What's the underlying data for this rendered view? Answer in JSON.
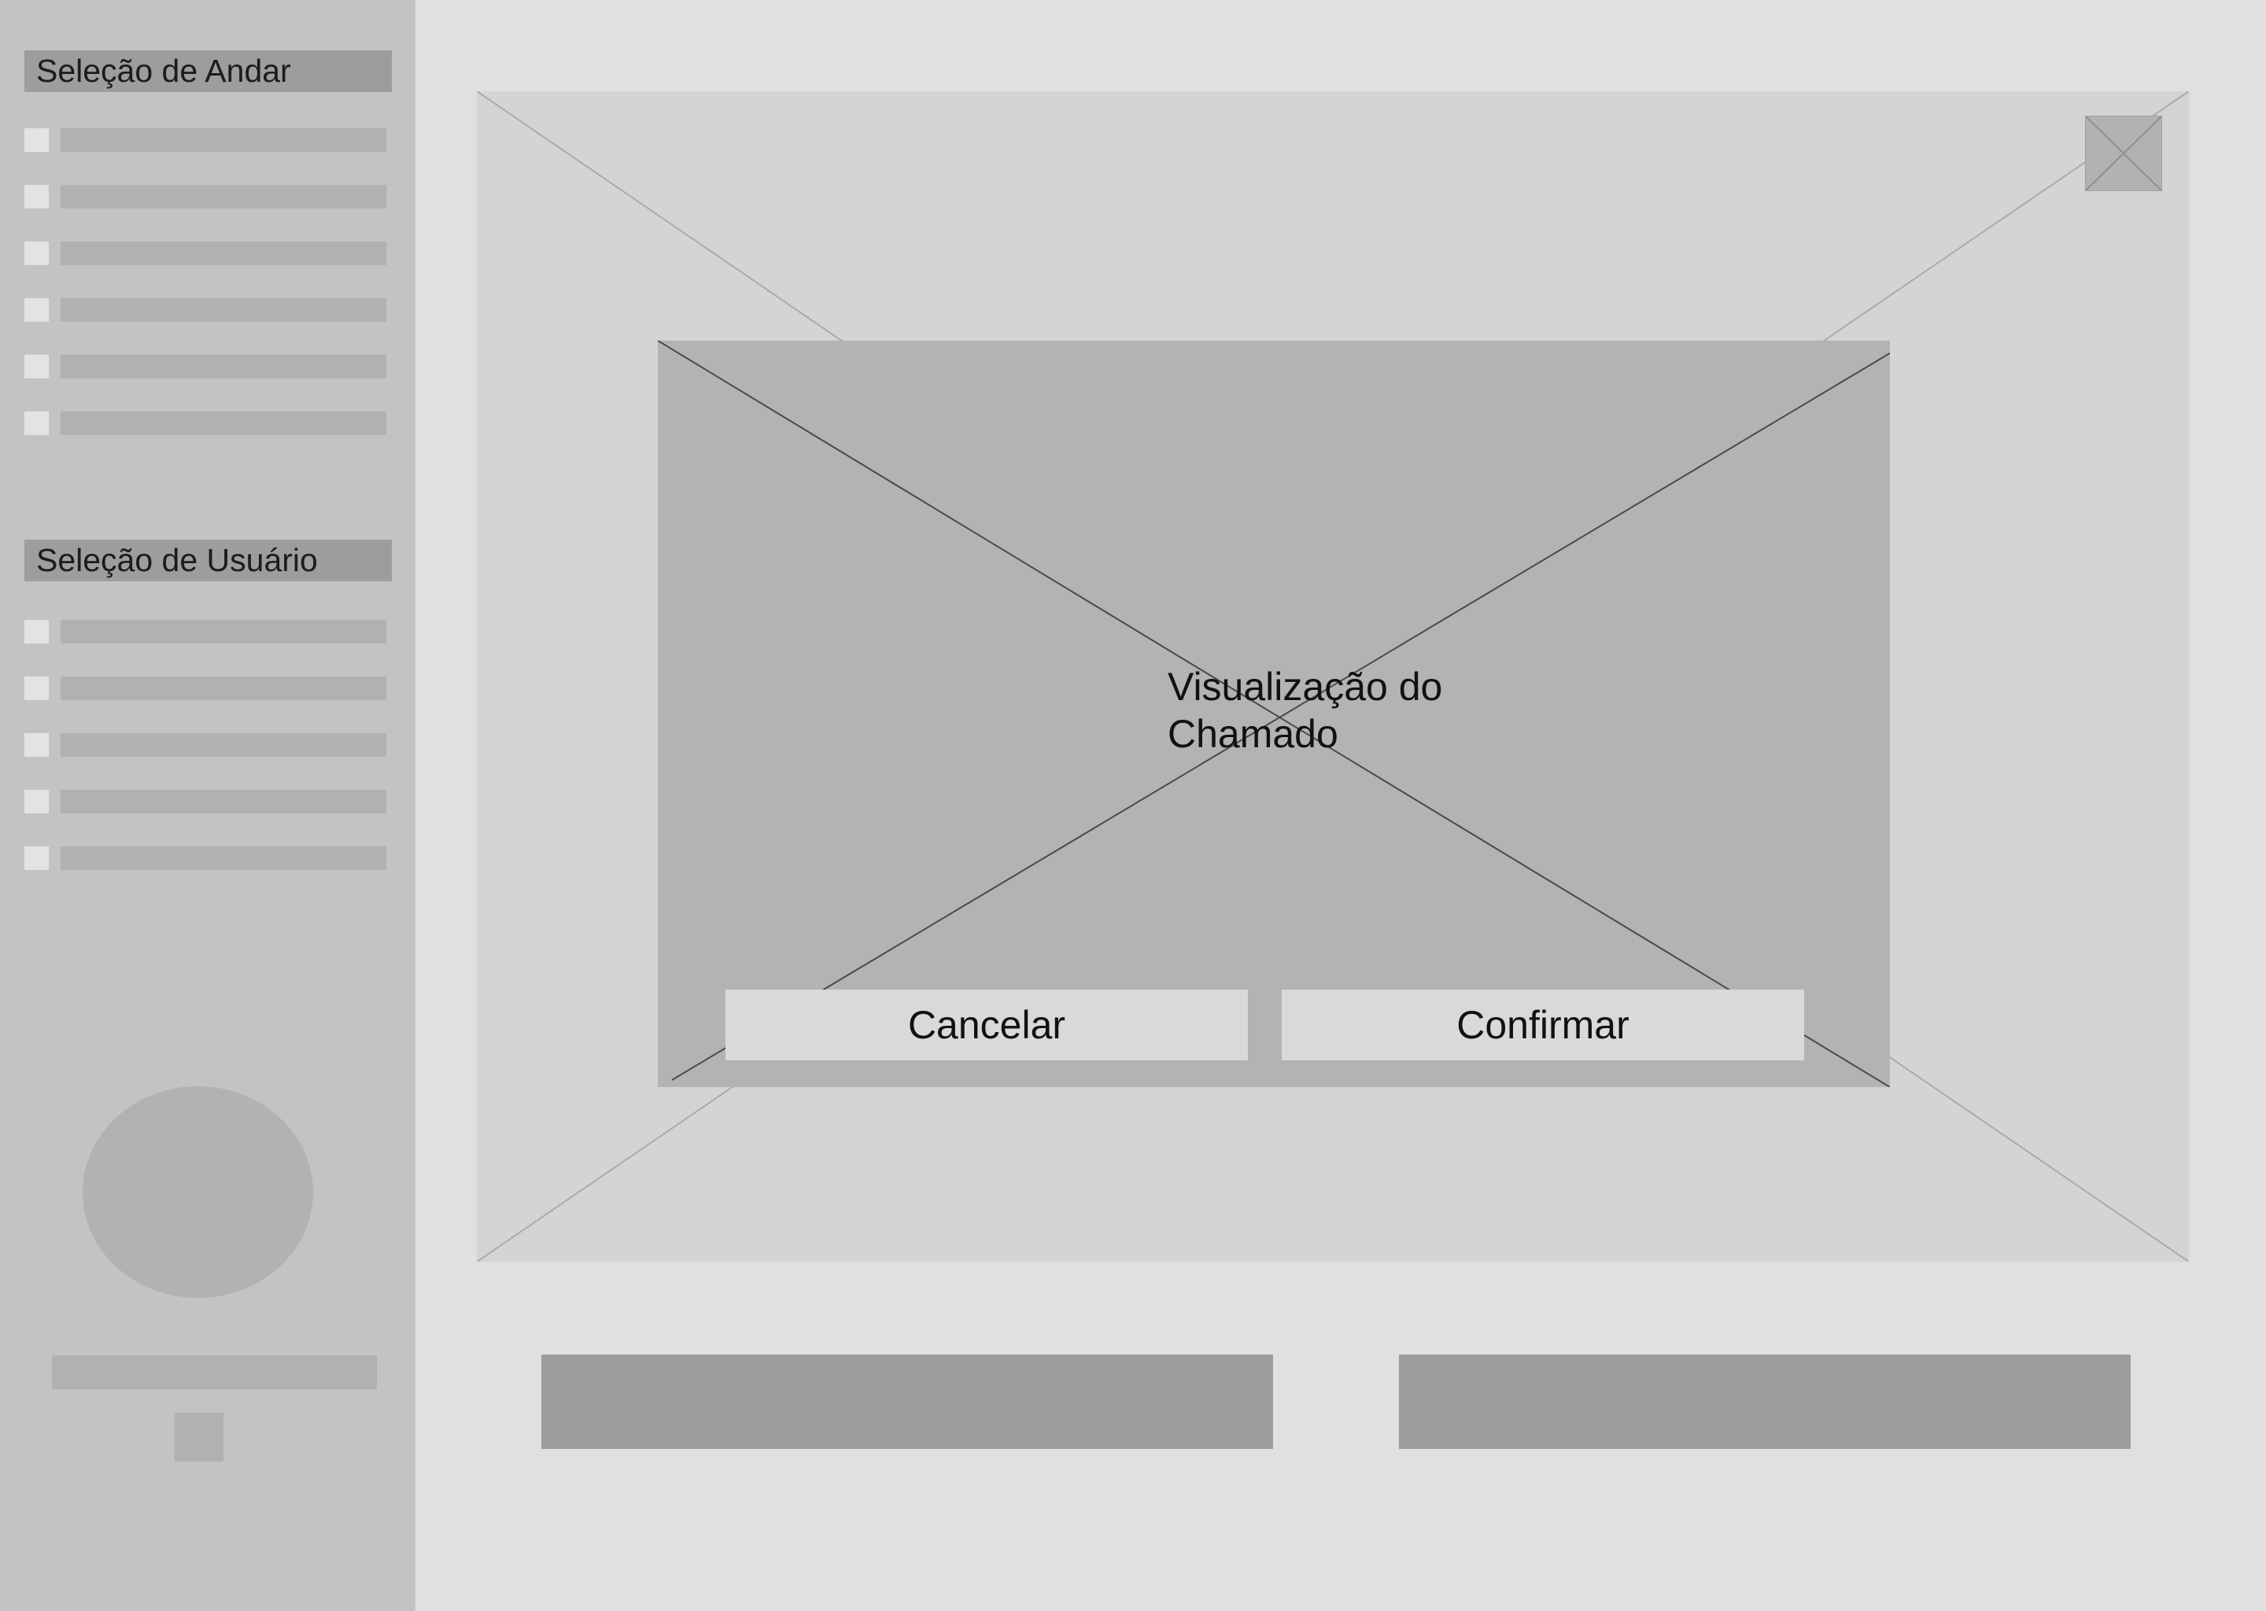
{
  "sidebar": {
    "floor_section": {
      "title": "Seleção de Andar",
      "item_count": 6
    },
    "user_section": {
      "title": "Seleção de Usuário",
      "item_count": 5
    }
  },
  "modal": {
    "title": "Visualização do Chamado",
    "cancel_label": "Cancelar",
    "confirm_label": "Confirmar"
  },
  "colors": {
    "page_background": "#e0e0e0",
    "sidebar_background": "#c3c3c3",
    "section_header": "#9e9d9b",
    "modal_background": "#b3b3b3",
    "button_background": "#d9d9d9"
  }
}
